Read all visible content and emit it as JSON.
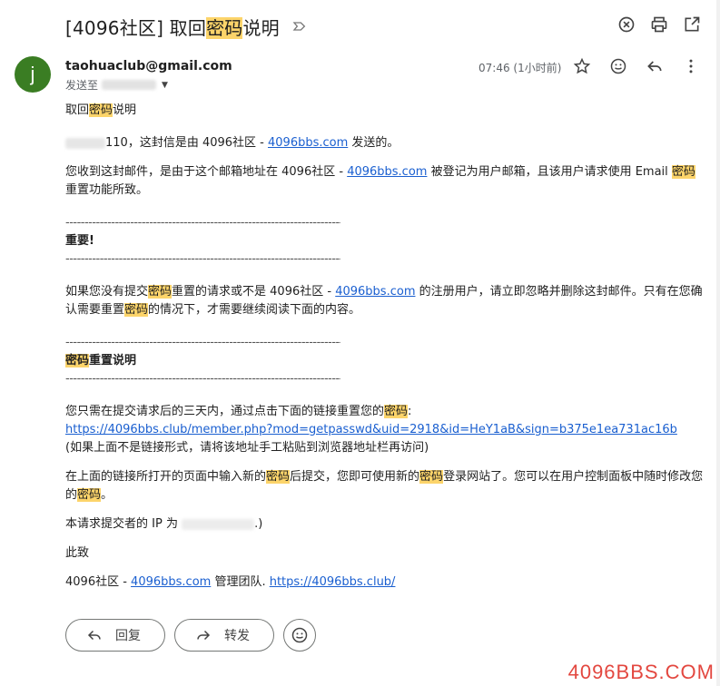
{
  "subject": {
    "prefix": "[4096社区] 取回",
    "highlight": "密码",
    "suffix": "说明"
  },
  "toolbar": {
    "close": "close",
    "print": "print",
    "open_new": "open-in-new-window"
  },
  "message": {
    "avatar_letter": "j",
    "sender": "taohuaclub@gmail.com",
    "recipient_prefix": "发送至",
    "time": "07:46 (1小时前)"
  },
  "body": {
    "l1_pre": "取回",
    "l1_hl": "密码",
    "l1_post": "说明",
    "l2_pre": "110，这封信是由 4096社区 - ",
    "l2_link": "4096bbs.com",
    "l2_post": " 发送的。",
    "l3_pre": "您收到这封邮件，是由于这个邮箱地址在 4096社区 - ",
    "l3_link": "4096bbs.com",
    "l3_mid": " 被登记为用户邮箱，且该用户请求使用 Email ",
    "l3_hl": "密码",
    "l3_post": "重置功能所致。",
    "dashes": "--------------------------------------------------------------------------------------------",
    "important": "重要!",
    "l4_pre": "如果您没有提交",
    "l4_hl1": "密码",
    "l4_mid1": "重置的请求或不是 4096社区 - ",
    "l4_link": "4096bbs.com",
    "l4_mid2": " 的注册用户，请立即忽略并删除这封邮件。只有在您确认需要重置",
    "l4_hl2": "密码",
    "l4_post": "的情况下，才需要继续阅读下面的内容。",
    "reset_hl": "密码",
    "reset_post": "重置说明",
    "l5_pre": "您只需在提交请求后的三天内，通过点击下面的链接重置您的",
    "l5_hl": "密码",
    "l5_post": ":",
    "reset_link": "https://4096bbs.club/member.php?mod=getpasswd&uid=2918&id=HeY1aB&sign=b375e1ea731ac16b",
    "l6": "(如果上面不是链接形式，请将该地址手工粘贴到浏览器地址栏再访问)",
    "l7_pre": "在上面的链接所打开的页面中输入新的",
    "l7_hl1": "密码",
    "l7_mid1": "后提交，您即可使用新的",
    "l7_hl2": "密码",
    "l7_mid2": "登录网站了。您可以在用户控制面板中随时修改您的",
    "l7_hl3": "密码",
    "l7_post": "。",
    "ip_pre": "本请求提交者的 IP 为 ",
    "ip_tail": ".)",
    "regards": "此致",
    "sig_pre": "4096社区 - ",
    "sig_link": "4096bbs.com",
    "sig_mid": " 管理团队. ",
    "sig_link2": "https://4096bbs.club/"
  },
  "actions": {
    "reply": "回复",
    "forward": "转发"
  },
  "watermark": "4096BBS.COM"
}
